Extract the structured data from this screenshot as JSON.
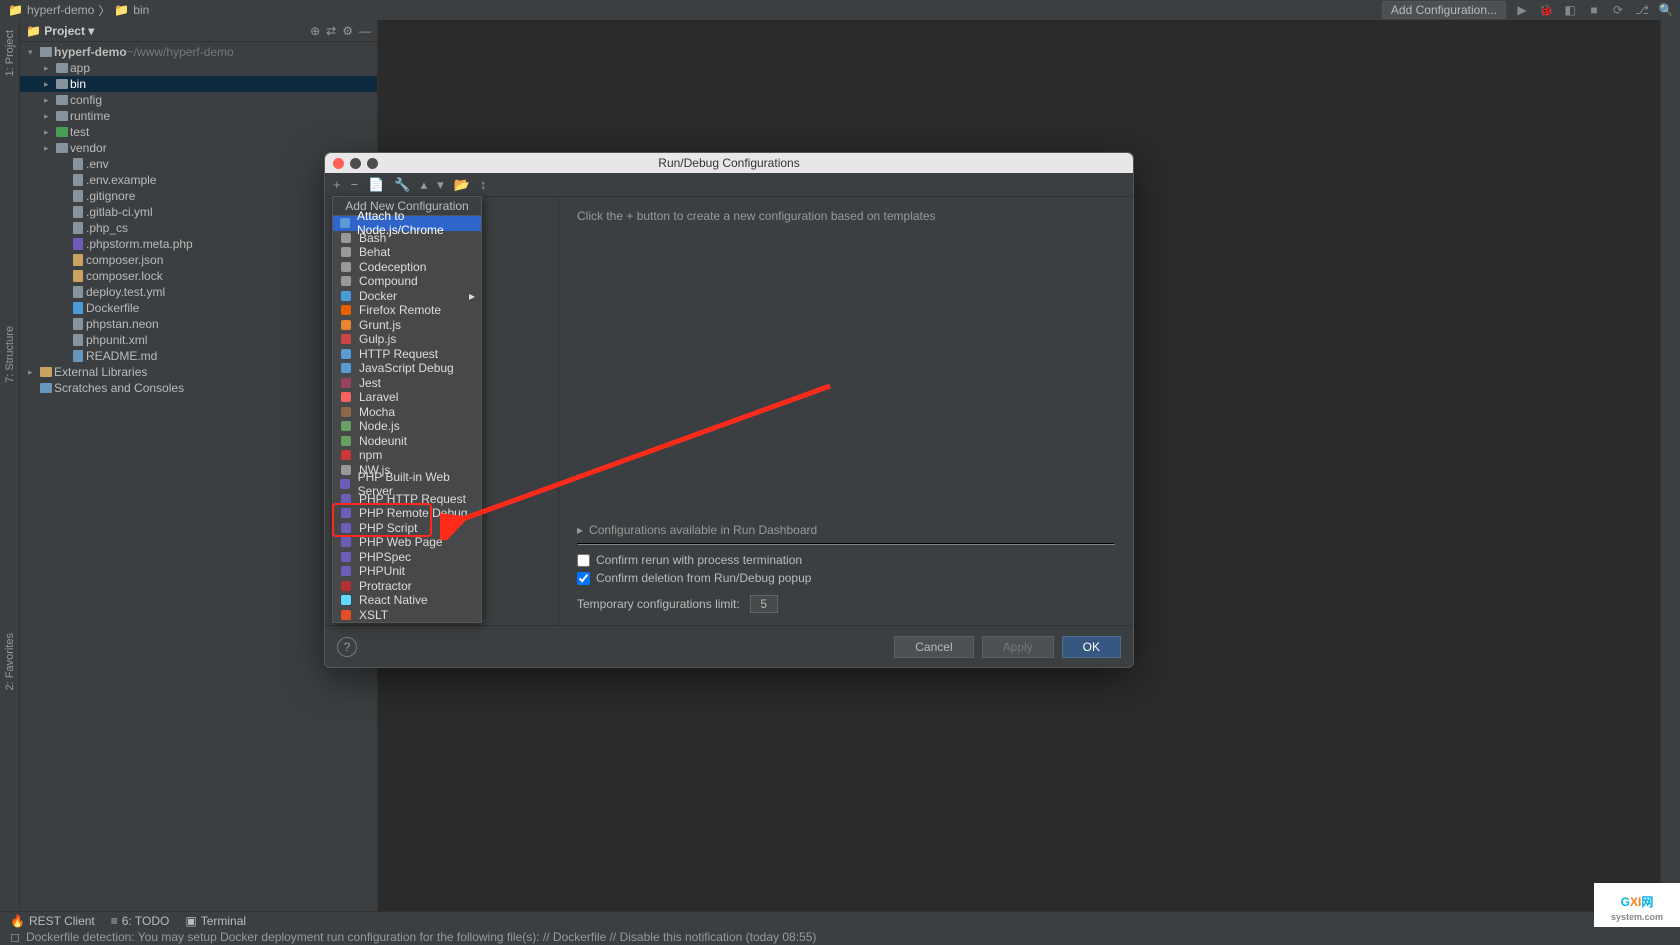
{
  "breadcrumb": {
    "root": "hyperf-demo",
    "current": "bin"
  },
  "toolbar": {
    "add_config": "Add Configuration..."
  },
  "project_panel": {
    "title": "Project"
  },
  "tree": {
    "root": {
      "name": "hyperf-demo",
      "path": "~/www/hyperf-demo"
    },
    "folders": [
      {
        "label": "app"
      },
      {
        "label": "bin",
        "selected": true
      },
      {
        "label": "config"
      },
      {
        "label": "runtime"
      },
      {
        "label": "test",
        "test": true
      },
      {
        "label": "vendor"
      }
    ],
    "files": [
      {
        "label": ".env",
        "t": "plain"
      },
      {
        "label": ".env.example",
        "t": "plain"
      },
      {
        "label": ".gitignore",
        "t": "plain"
      },
      {
        "label": ".gitlab-ci.yml",
        "t": "plain"
      },
      {
        "label": ".php_cs",
        "t": "plain"
      },
      {
        "label": ".phpstorm.meta.php",
        "t": "php"
      },
      {
        "label": "composer.json",
        "t": "json"
      },
      {
        "label": "composer.lock",
        "t": "json"
      },
      {
        "label": "deploy.test.yml",
        "t": "plain"
      },
      {
        "label": "Dockerfile",
        "t": "docker"
      },
      {
        "label": "phpstan.neon",
        "t": "plain"
      },
      {
        "label": "phpunit.xml",
        "t": "plain"
      },
      {
        "label": "README.md",
        "t": "md"
      }
    ],
    "external": "External Libraries",
    "scratches": "Scratches and Consoles"
  },
  "left_tabs": {
    "project": "1: Project",
    "structure": "7: Structure",
    "favorites": "2: Favorites"
  },
  "modal": {
    "title": "Run/Debug Configurations",
    "hint": "Click the  +  button to create a new configuration based on templates",
    "dash": "Configurations available in Run Dashboard",
    "confirm_rerun": "Confirm rerun with process termination",
    "confirm_delete": "Confirm deletion from Run/Debug popup",
    "limit_label": "Temporary configurations limit:",
    "limit_value": "5",
    "cancel": "Cancel",
    "apply": "Apply",
    "ok": "OK"
  },
  "popup": {
    "header": "Add New Configuration",
    "items": [
      {
        "label": "Attach to Node.js/Chrome",
        "sel": true,
        "c": "#5b9bd5"
      },
      {
        "label": "Bash",
        "c": "#999"
      },
      {
        "label": "Behat",
        "c": "#999"
      },
      {
        "label": "Codeception",
        "c": "#999"
      },
      {
        "label": "Compound",
        "c": "#999"
      },
      {
        "label": "Docker",
        "arrow": true,
        "c": "#4a9cd6"
      },
      {
        "label": "Firefox Remote",
        "c": "#e66000"
      },
      {
        "label": "Grunt.js",
        "c": "#e48632"
      },
      {
        "label": "Gulp.js",
        "c": "#cf4647"
      },
      {
        "label": "HTTP Request",
        "c": "#5b9bd5"
      },
      {
        "label": "JavaScript Debug",
        "c": "#5b9bd5"
      },
      {
        "label": "Jest",
        "c": "#99425b"
      },
      {
        "label": "Laravel",
        "c": "#f4645f"
      },
      {
        "label": "Mocha",
        "c": "#8d6748"
      },
      {
        "label": "Node.js",
        "c": "#68a063"
      },
      {
        "label": "Nodeunit",
        "c": "#68a063"
      },
      {
        "label": "npm",
        "c": "#cb3837"
      },
      {
        "label": "NW.js",
        "c": "#999"
      },
      {
        "label": "PHP Built-in Web Server",
        "c": "#6e5cb8"
      },
      {
        "label": "PHP HTTP Request",
        "c": "#6e5cb8"
      },
      {
        "label": "PHP Remote Debug",
        "c": "#6e5cb8"
      },
      {
        "label": "PHP Script",
        "c": "#6e5cb8"
      },
      {
        "label": "PHP Web Page",
        "c": "#6e5cb8"
      },
      {
        "label": "PHPSpec",
        "c": "#6e5cb8"
      },
      {
        "label": "PHPUnit",
        "c": "#6e5cb8"
      },
      {
        "label": "Protractor",
        "c": "#b52e31"
      },
      {
        "label": "React Native",
        "c": "#61dafb"
      },
      {
        "label": "XSLT",
        "c": "#e44d26"
      }
    ]
  },
  "status": {
    "rest": "REST Client",
    "todo": "6: TODO",
    "terminal": "Terminal"
  },
  "notification": "Dockerfile detection: You may setup Docker deployment run configuration for the following file(s): // Dockerfile // Disable this notification (today 08:55)",
  "watermark": {
    "l1a": "G",
    "l1b": "XI",
    "l1c": "网",
    "l2": "system.com"
  }
}
